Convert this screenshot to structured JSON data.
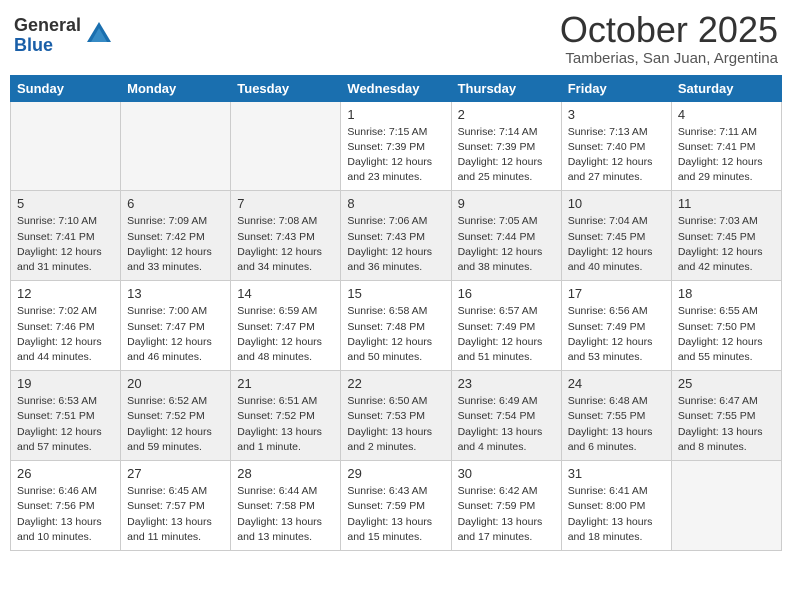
{
  "header": {
    "logo_general": "General",
    "logo_blue": "Blue",
    "month": "October 2025",
    "location": "Tamberias, San Juan, Argentina"
  },
  "weekdays": [
    "Sunday",
    "Monday",
    "Tuesday",
    "Wednesday",
    "Thursday",
    "Friday",
    "Saturday"
  ],
  "weeks": [
    {
      "rowStyle": "white",
      "days": [
        {
          "num": "",
          "info": ""
        },
        {
          "num": "",
          "info": ""
        },
        {
          "num": "",
          "info": ""
        },
        {
          "num": "1",
          "info": "Sunrise: 7:15 AM\nSunset: 7:39 PM\nDaylight: 12 hours\nand 23 minutes."
        },
        {
          "num": "2",
          "info": "Sunrise: 7:14 AM\nSunset: 7:39 PM\nDaylight: 12 hours\nand 25 minutes."
        },
        {
          "num": "3",
          "info": "Sunrise: 7:13 AM\nSunset: 7:40 PM\nDaylight: 12 hours\nand 27 minutes."
        },
        {
          "num": "4",
          "info": "Sunrise: 7:11 AM\nSunset: 7:41 PM\nDaylight: 12 hours\nand 29 minutes."
        }
      ]
    },
    {
      "rowStyle": "gray",
      "days": [
        {
          "num": "5",
          "info": "Sunrise: 7:10 AM\nSunset: 7:41 PM\nDaylight: 12 hours\nand 31 minutes."
        },
        {
          "num": "6",
          "info": "Sunrise: 7:09 AM\nSunset: 7:42 PM\nDaylight: 12 hours\nand 33 minutes."
        },
        {
          "num": "7",
          "info": "Sunrise: 7:08 AM\nSunset: 7:43 PM\nDaylight: 12 hours\nand 34 minutes."
        },
        {
          "num": "8",
          "info": "Sunrise: 7:06 AM\nSunset: 7:43 PM\nDaylight: 12 hours\nand 36 minutes."
        },
        {
          "num": "9",
          "info": "Sunrise: 7:05 AM\nSunset: 7:44 PM\nDaylight: 12 hours\nand 38 minutes."
        },
        {
          "num": "10",
          "info": "Sunrise: 7:04 AM\nSunset: 7:45 PM\nDaylight: 12 hours\nand 40 minutes."
        },
        {
          "num": "11",
          "info": "Sunrise: 7:03 AM\nSunset: 7:45 PM\nDaylight: 12 hours\nand 42 minutes."
        }
      ]
    },
    {
      "rowStyle": "white",
      "days": [
        {
          "num": "12",
          "info": "Sunrise: 7:02 AM\nSunset: 7:46 PM\nDaylight: 12 hours\nand 44 minutes."
        },
        {
          "num": "13",
          "info": "Sunrise: 7:00 AM\nSunset: 7:47 PM\nDaylight: 12 hours\nand 46 minutes."
        },
        {
          "num": "14",
          "info": "Sunrise: 6:59 AM\nSunset: 7:47 PM\nDaylight: 12 hours\nand 48 minutes."
        },
        {
          "num": "15",
          "info": "Sunrise: 6:58 AM\nSunset: 7:48 PM\nDaylight: 12 hours\nand 50 minutes."
        },
        {
          "num": "16",
          "info": "Sunrise: 6:57 AM\nSunset: 7:49 PM\nDaylight: 12 hours\nand 51 minutes."
        },
        {
          "num": "17",
          "info": "Sunrise: 6:56 AM\nSunset: 7:49 PM\nDaylight: 12 hours\nand 53 minutes."
        },
        {
          "num": "18",
          "info": "Sunrise: 6:55 AM\nSunset: 7:50 PM\nDaylight: 12 hours\nand 55 minutes."
        }
      ]
    },
    {
      "rowStyle": "gray",
      "days": [
        {
          "num": "19",
          "info": "Sunrise: 6:53 AM\nSunset: 7:51 PM\nDaylight: 12 hours\nand 57 minutes."
        },
        {
          "num": "20",
          "info": "Sunrise: 6:52 AM\nSunset: 7:52 PM\nDaylight: 12 hours\nand 59 minutes."
        },
        {
          "num": "21",
          "info": "Sunrise: 6:51 AM\nSunset: 7:52 PM\nDaylight: 13 hours\nand 1 minute."
        },
        {
          "num": "22",
          "info": "Sunrise: 6:50 AM\nSunset: 7:53 PM\nDaylight: 13 hours\nand 2 minutes."
        },
        {
          "num": "23",
          "info": "Sunrise: 6:49 AM\nSunset: 7:54 PM\nDaylight: 13 hours\nand 4 minutes."
        },
        {
          "num": "24",
          "info": "Sunrise: 6:48 AM\nSunset: 7:55 PM\nDaylight: 13 hours\nand 6 minutes."
        },
        {
          "num": "25",
          "info": "Sunrise: 6:47 AM\nSunset: 7:55 PM\nDaylight: 13 hours\nand 8 minutes."
        }
      ]
    },
    {
      "rowStyle": "white",
      "days": [
        {
          "num": "26",
          "info": "Sunrise: 6:46 AM\nSunset: 7:56 PM\nDaylight: 13 hours\nand 10 minutes."
        },
        {
          "num": "27",
          "info": "Sunrise: 6:45 AM\nSunset: 7:57 PM\nDaylight: 13 hours\nand 11 minutes."
        },
        {
          "num": "28",
          "info": "Sunrise: 6:44 AM\nSunset: 7:58 PM\nDaylight: 13 hours\nand 13 minutes."
        },
        {
          "num": "29",
          "info": "Sunrise: 6:43 AM\nSunset: 7:59 PM\nDaylight: 13 hours\nand 15 minutes."
        },
        {
          "num": "30",
          "info": "Sunrise: 6:42 AM\nSunset: 7:59 PM\nDaylight: 13 hours\nand 17 minutes."
        },
        {
          "num": "31",
          "info": "Sunrise: 6:41 AM\nSunset: 8:00 PM\nDaylight: 13 hours\nand 18 minutes."
        },
        {
          "num": "",
          "info": ""
        }
      ]
    }
  ]
}
